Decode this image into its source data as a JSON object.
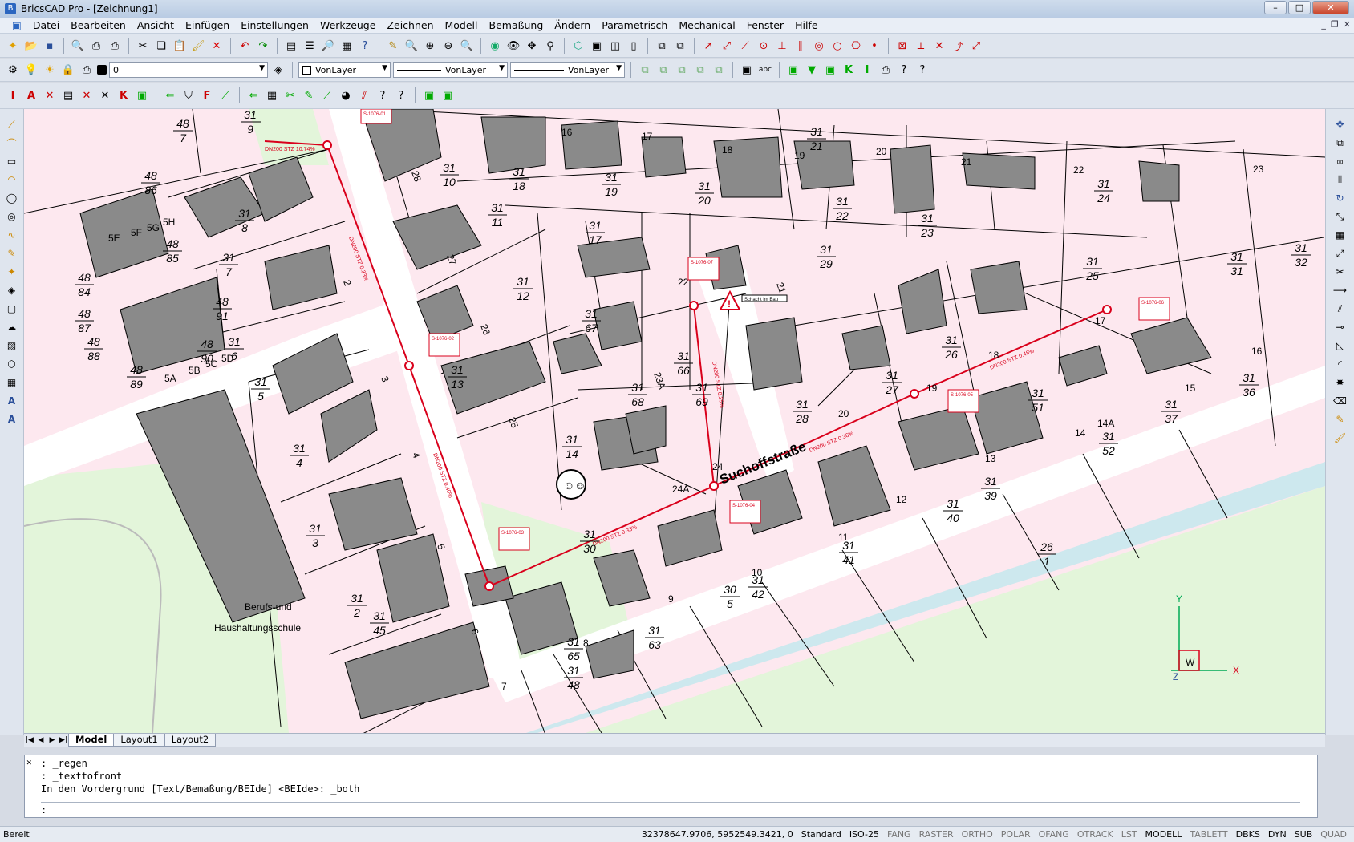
{
  "window": {
    "title": "BricsCAD Pro - [Zeichnung1]"
  },
  "menu": [
    "Datei",
    "Bearbeiten",
    "Ansicht",
    "Einfügen",
    "Einstellungen",
    "Werkzeuge",
    "Zeichnen",
    "Modell",
    "Bemaßung",
    "Ändern",
    "Parametrisch",
    "Mechanical",
    "Fenster",
    "Hilfe"
  ],
  "layer_toolbar": {
    "layer": "0",
    "color": "VonLayer",
    "linetype": "VonLayer",
    "lineweight": "VonLayer"
  },
  "drawing": {
    "street_label": "Suchoffstraße",
    "school_label_1": "Berufs-und",
    "school_label_2": "Haushaltungsschule",
    "parcels": [
      [
        "31",
        "9"
      ],
      [
        "48",
        "7"
      ],
      [
        "48",
        "86"
      ],
      [
        "48",
        "85"
      ],
      [
        "48",
        "84"
      ],
      [
        "48",
        "87"
      ],
      [
        "48",
        "88"
      ],
      [
        "48",
        "89"
      ],
      [
        "48",
        "90"
      ],
      [
        "48",
        "91"
      ],
      [
        "31",
        "8"
      ],
      [
        "31",
        "7"
      ],
      [
        "31",
        "6"
      ],
      [
        "31",
        "5"
      ],
      [
        "31",
        "4"
      ],
      [
        "31",
        "3"
      ],
      [
        "31",
        "2"
      ],
      [
        "31",
        "45"
      ],
      [
        "31",
        "10"
      ],
      [
        "31",
        "11"
      ],
      [
        "31",
        "12"
      ],
      [
        "31",
        "13"
      ],
      [
        "31",
        "14"
      ],
      [
        "31",
        "18"
      ],
      [
        "31",
        "17"
      ],
      [
        "31",
        "19"
      ],
      [
        "31",
        "20"
      ],
      [
        "31",
        "21"
      ],
      [
        "31",
        "22"
      ],
      [
        "31",
        "23"
      ],
      [
        "31",
        "24"
      ],
      [
        "31",
        "29"
      ],
      [
        "31",
        "25"
      ],
      [
        "31",
        "26"
      ],
      [
        "31",
        "27"
      ],
      [
        "31",
        "28"
      ],
      [
        "31",
        "67"
      ],
      [
        "31",
        "66"
      ],
      [
        "31",
        "68"
      ],
      [
        "31",
        "69"
      ],
      [
        "31",
        "30"
      ],
      [
        "31",
        "63"
      ],
      [
        "31",
        "65"
      ],
      [
        "31",
        "48"
      ],
      [
        "31",
        "42"
      ],
      [
        "30",
        "5"
      ],
      [
        "31",
        "41"
      ],
      [
        "31",
        "40"
      ],
      [
        "31",
        "39"
      ],
      [
        "31",
        "52"
      ],
      [
        "31",
        "51"
      ],
      [
        "31",
        "37"
      ],
      [
        "31",
        "36"
      ],
      [
        "31",
        "31"
      ],
      [
        "31",
        "32"
      ],
      [
        "26",
        "1"
      ]
    ],
    "houses": [
      "16",
      "17",
      "18",
      "19",
      "20",
      "21",
      "22",
      "23",
      "28",
      "27",
      "26",
      "25",
      "24",
      "24A",
      "23A",
      "21",
      "22",
      "20",
      "19",
      "18",
      "17",
      "16",
      "15",
      "14",
      "14A",
      "13",
      "12",
      "11",
      "10",
      "9",
      "8",
      "7",
      "6",
      "5",
      "4",
      "3",
      "2",
      "5E",
      "5F",
      "5G",
      "5H",
      "5A",
      "5B",
      "5C",
      "5D"
    ],
    "pipe_labels": [
      "DN200 STZ 10.74%",
      "DN200 STZ 0.33%",
      "DN200 STZ 0.48%",
      "DN200 STZ 0.35%",
      "DN200 STZ 0.36%",
      "DN200 STZ 0.33%",
      "DN200 STZ 0.40%"
    ],
    "manholes": [
      "S-1076-01",
      "S-1076-02",
      "S-1076-03",
      "S-1076-04",
      "S-1076-05",
      "S-1076-06",
      "S-1076-07"
    ],
    "warning_label": "Schacht im Bau",
    "ucs": {
      "x": "X",
      "y": "Y",
      "z": "Z",
      "w": "W"
    }
  },
  "tabs": [
    "Model",
    "Layout1",
    "Layout2"
  ],
  "command": {
    "history": [
      ": _regen",
      ": _texttofront",
      "In den Vordergrund [Text/Bemaßung/BEIde] <BEIde>: _both"
    ],
    "prompt": ":"
  },
  "status": {
    "ready": "Bereit",
    "coords": "32378647.9706, 5952549.3421, 0",
    "style": "Standard",
    "dimstyle": "ISO-25",
    "toggles": [
      "FANG",
      "RASTER",
      "ORTHO",
      "POLAR",
      "OFANG",
      "OTRACK",
      "LST",
      "MODELL",
      "TABLETT",
      "DBKS",
      "DYN",
      "SUB",
      "QUAD"
    ]
  },
  "colors": {
    "parcel_fill": "#fde8ef",
    "building": "#8a8a8a",
    "sewer": "#d9001b",
    "green": "#e3f5da"
  }
}
